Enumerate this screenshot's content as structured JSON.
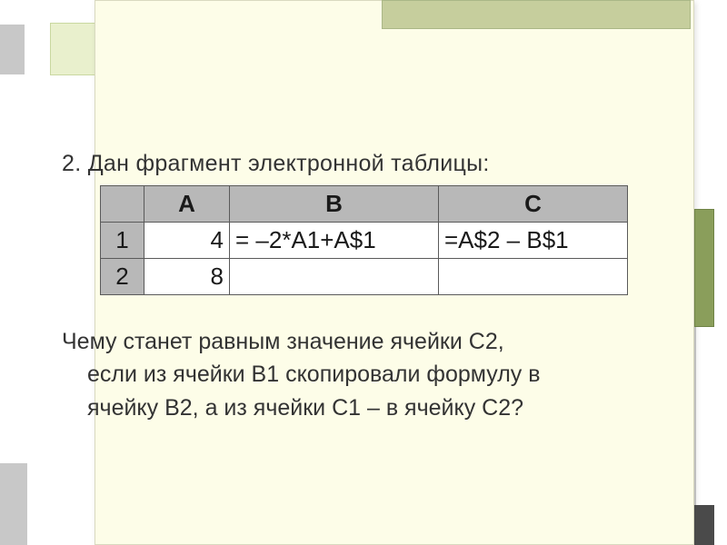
{
  "intro": "2. Дан фрагмент электронной таблицы:",
  "table": {
    "headers": {
      "corner": "",
      "A": "A",
      "B": "B",
      "C": "C"
    },
    "rows": [
      {
        "n": "1",
        "A": "4",
        "B": "= –2*A1+A$1",
        "C": "=A$2 – B$1"
      },
      {
        "n": "2",
        "A": "8",
        "B": "",
        "C": ""
      }
    ]
  },
  "body": {
    "l1": "Чему станет равным значение ячейки С2,",
    "l2": "если из ячейки В1 скопировали формулу в",
    "l3": "ячейку В2, а из ячейки С1 – в ячейку С2?",
    "l4": ""
  }
}
